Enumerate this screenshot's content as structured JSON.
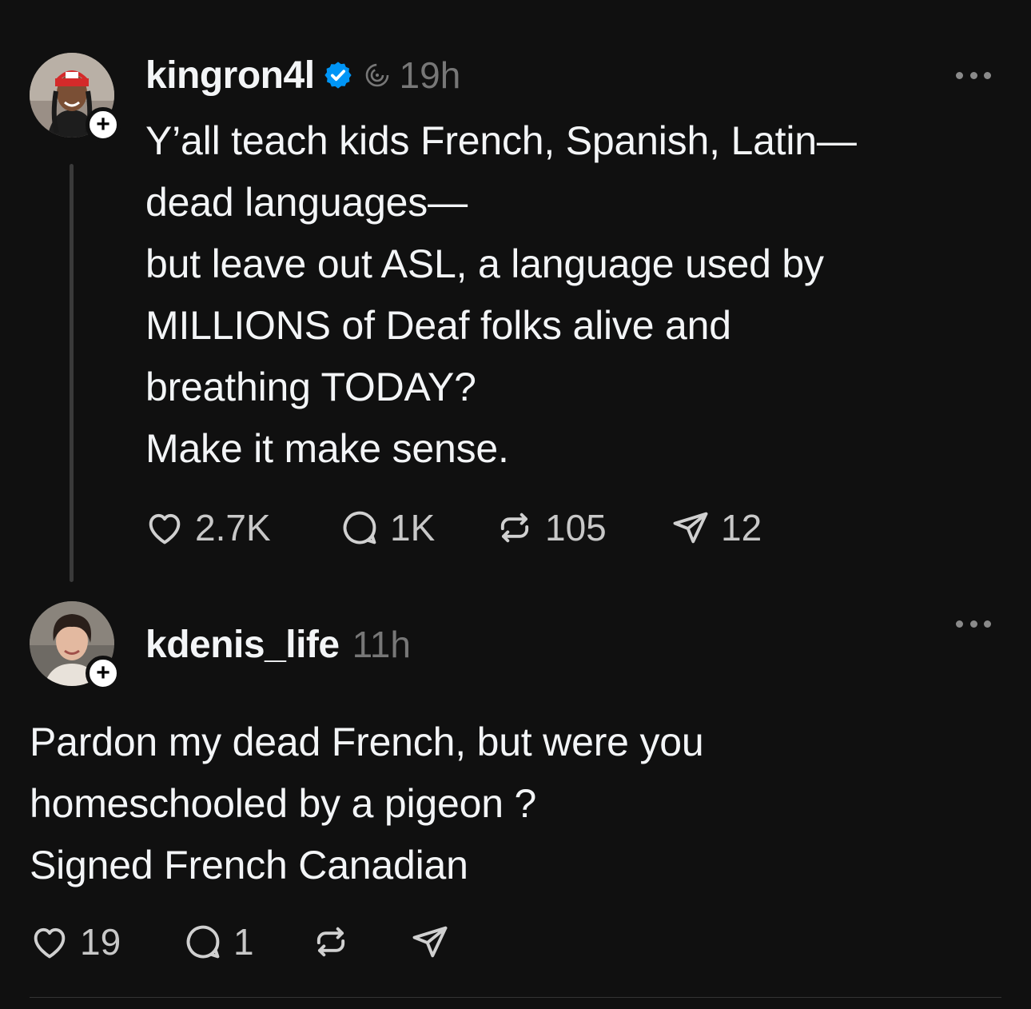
{
  "posts": [
    {
      "username": "kingron4l",
      "verified": true,
      "time": "19h",
      "paragraphs": [
        "Y’all teach kids French, Spanish, Latin—\ndead languages—",
        "but leave out ASL, a language used by\nMILLIONS of Deaf folks alive and\nbreathing TODAY?",
        "Make it make sense."
      ],
      "likes": "2.7K",
      "replies": "1K",
      "reposts": "105",
      "shares": "12"
    },
    {
      "username": "kdenis_life",
      "verified": false,
      "time": "11h",
      "paragraphs": [
        "Pardon my dead French, but were you\nhomeschooled by a pigeon ?",
        "Signed French Canadian"
      ],
      "likes": "19",
      "replies": "1",
      "reposts": "",
      "shares": ""
    }
  ],
  "icons": {
    "like": "heart-icon",
    "reply": "comment-bubble-icon",
    "repost": "repost-arrows-icon",
    "share": "send-plane-icon",
    "more": "more-dots-icon",
    "verified": "verified-badge-icon",
    "follow": "plus-icon"
  },
  "colors": {
    "background": "#101010",
    "text": "#f3f5f7",
    "muted": "#777777",
    "verified": "#0095f6"
  }
}
